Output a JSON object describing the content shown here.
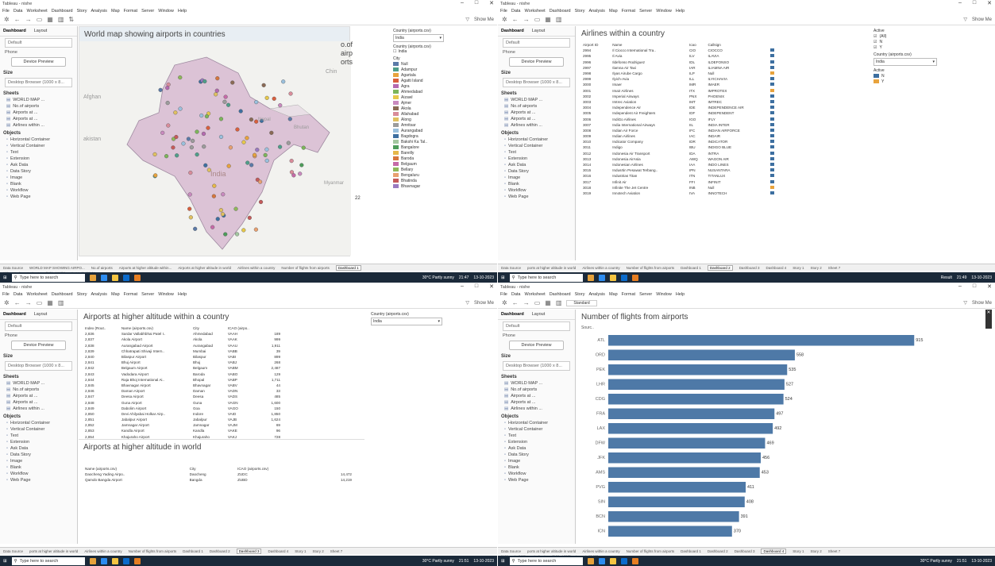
{
  "window_title": "Tableau - nishe",
  "menu": [
    "File",
    "Data",
    "Worksheet",
    "Dashboard",
    "Story",
    "Analysis",
    "Map",
    "Format",
    "Server",
    "Window",
    "Help"
  ],
  "show_me": "Show Me",
  "left_panel": {
    "tab_dashboard": "Dashboard",
    "tab_layout": "Layout",
    "default_label": "Default",
    "phone_label": "Phone",
    "device_preview": "Device Preview",
    "size_header": "Size",
    "size_value": "Desktop Browser (1000 x 8...",
    "sheets_header": "Sheets",
    "sheets": [
      "WORLD MAP ...",
      "No.of airports",
      "Airports at ...",
      "Airports at ...",
      "Airlines within ..."
    ],
    "objects_header": "Objects",
    "objects": [
      "Horizontal Container",
      "Vertical Container",
      "Text",
      "Extension",
      "Ask Data",
      "Data Story",
      "Image",
      "Blank",
      "Workflow",
      "Web Page"
    ]
  },
  "q1": {
    "title": "World map showing airports in countries",
    "overlay_text": "o.of\nairp\norts",
    "map_labels": [
      "Chin",
      "Afghan",
      "akistan",
      "Nepal",
      "Bhutan",
      "India",
      "Myanmar"
    ],
    "count_label": "22",
    "filter_label": "Country (airports.csv)",
    "filter_value": "India",
    "filter2_label": "Country (airports.csv)",
    "filter2_value": "India",
    "city_header": "City",
    "cities": [
      {
        "name": "Null",
        "color": "#5b7aa8"
      },
      {
        "name": "Adampur",
        "color": "#4f9e8a"
      },
      {
        "name": "Agartala",
        "color": "#e8a33d"
      },
      {
        "name": "Agatti Island",
        "color": "#d95f3d"
      },
      {
        "name": "Agra",
        "color": "#b56ab0"
      },
      {
        "name": "Ahmedabad",
        "color": "#7cb55a"
      },
      {
        "name": "Aizawl",
        "color": "#e6c84a"
      },
      {
        "name": "Ajmer",
        "color": "#c98abf"
      },
      {
        "name": "Akola",
        "color": "#8a6a55"
      },
      {
        "name": "Allahabad",
        "color": "#d98c9a"
      },
      {
        "name": "Along",
        "color": "#e0c060"
      },
      {
        "name": "Amritsar",
        "color": "#9c9c9c"
      },
      {
        "name": "Aurangabad",
        "color": "#9ac0dd"
      },
      {
        "name": "Bagdogra",
        "color": "#3d6fa0"
      },
      {
        "name": "Bakshi Ka Tal..",
        "color": "#a3c7a0"
      },
      {
        "name": "Bangalore",
        "color": "#4d9c5a"
      },
      {
        "name": "Bareilly",
        "color": "#e6b84a"
      },
      {
        "name": "Baroda",
        "color": "#d6763d"
      },
      {
        "name": "Belgaum",
        "color": "#c66aa8"
      },
      {
        "name": "Bellary",
        "color": "#8fb85a"
      },
      {
        "name": "Bengaluru",
        "color": "#e8a070"
      },
      {
        "name": "Bhatinda",
        "color": "#c55a5a"
      },
      {
        "name": "Bhavnagar",
        "color": "#9a7ac0"
      }
    ],
    "tabs": [
      "Data Source",
      "WORLD MAP SHOWING AIRPO...",
      "No.of airports",
      "Airports at higher altitude within...",
      "Airports at higher altitude in world",
      "Airlines within a country",
      "Number of flights from airports",
      "Dashboard 1"
    ],
    "status": "149 marks  1 row by 1 column  SUM of AVG(Longitude): 11,900.94",
    "weather": "30°C  Partly sunny",
    "time": "21:47",
    "date": "13-10-2023",
    "search": "Type here to search"
  },
  "q2": {
    "title": "Airlines within a country",
    "columns": [
      "Airport ID",
      "Name",
      "Icao",
      "Callsign"
    ],
    "rows": [
      [
        "2994",
        "Il Ciocco International Tra..",
        "CIO",
        "CIOCCO"
      ],
      [
        "2995",
        "Il Avia",
        "ILV",
        "ILAVIA"
      ],
      [
        "2996",
        "Ildefonso Rodriguez",
        "IDL",
        "ILDEFONSO"
      ],
      [
        "2997",
        "Ilamna Air Taxi",
        "IAR",
        "ILIAMNA AIR"
      ],
      [
        "2998",
        "Ilyas Airube Cargo",
        "ILP",
        "Null"
      ],
      [
        "2999",
        "Ilyich-Avia",
        "ILL",
        "ILYICHAVIA"
      ],
      [
        "3000",
        "Imaer",
        "IMR",
        "IMAER"
      ],
      [
        "3001",
        "Imair Airlines",
        "ITX",
        "IMPROTEX"
      ],
      [
        "3002",
        "Imperial Airways",
        "PNX",
        "PHOENIX"
      ],
      [
        "3003",
        "Imtrec Aviation",
        "IMT",
        "IMTREC"
      ],
      [
        "3004",
        "Independence Air",
        "IDE",
        "INDEPENDENCE AIR"
      ],
      [
        "3005",
        "Independent Air Freighters",
        "IDF",
        "INDEPENDENT"
      ],
      [
        "3006",
        "IndiGo Airlines",
        "IGO",
        "IFLY"
      ],
      [
        "3007",
        "India International Airways",
        "IIL",
        "INDIA INTER"
      ],
      [
        "3008",
        "Indian Air Force",
        "IFC",
        "INDIAN AIRFORCE"
      ],
      [
        "3009",
        "Indian Airlines",
        "IAC",
        "INDAIR"
      ],
      [
        "3010",
        "Indicator Company",
        "IDR",
        "INDICATOR"
      ],
      [
        "3011",
        "Indigo",
        "IBU",
        "INDIGO BLUE"
      ],
      [
        "3012",
        "Indonesia Air Transport",
        "IDA",
        "INTRA"
      ],
      [
        "3013",
        "Indonesia AirAsia",
        "AWQ",
        "WAGON AIR"
      ],
      [
        "3014",
        "Indonesian Airlines",
        "IAA",
        "INDO LINES"
      ],
      [
        "3015",
        "Indusrtin Pesawat Terbang..",
        "IPN",
        "NUSANTARA"
      ],
      [
        "3016",
        "Industrias Titan",
        "ITN",
        "TITANLUX"
      ],
      [
        "3017",
        "Infinit Air",
        "FFI",
        "INFINIT"
      ],
      [
        "3018",
        "Infinite The Jet Centre",
        "INB",
        "Null"
      ],
      [
        "3019",
        "Innotech Aviation",
        "IVA",
        "INNOTECH"
      ]
    ],
    "row_colors": [
      "#3d6fa0",
      "#3d6fa0",
      "#3d6fa0",
      "#3d6fa0",
      "#e8a33d",
      "#3d6fa0",
      "#3d6fa0",
      "#e8a33d",
      "#3d6fa0",
      "#3d6fa0",
      "#3d6fa0",
      "#3d6fa0",
      "#3d6fa0",
      "#3d6fa0",
      "#3d6fa0",
      "#3d6fa0",
      "#3d6fa0",
      "#3d6fa0",
      "#3d6fa0",
      "#3d6fa0",
      "#3d6fa0",
      "#3d6fa0",
      "#3d6fa0",
      "#3d6fa0",
      "#e8a33d",
      "#3d6fa0"
    ],
    "active_label": "Active",
    "active_options": [
      "(All)",
      "N",
      "Y"
    ],
    "country_label": "Country (airports.csv)",
    "country_value": "India",
    "active_legend": [
      {
        "name": "N",
        "color": "#3d6fa0"
      },
      {
        "name": "Y",
        "color": "#e8a33d"
      }
    ],
    "tabs": [
      "Data Source",
      "ports at higher altitude in world",
      "Airlines within a country",
      "Number of flights from airports",
      "Dashboard 1",
      "Dashboard 2",
      "Dashboard 3",
      "Dashboard 4",
      "Story 1",
      "Story 2",
      "Sheet 7"
    ],
    "tray": "Result",
    "time": "21:49",
    "date": "13-10-2023",
    "search": "Type here to search"
  },
  "q3": {
    "title": "Airports at higher altitude within a country",
    "columns": [
      "Index (Rout..",
      "Name (airports.csv)",
      "City",
      "ICAO (airpo.."
    ],
    "rows": [
      [
        "2,836",
        "Sardar Vallabhbhai Patel I..",
        "Ahmedabad",
        "VAAH",
        "189"
      ],
      [
        "2,837",
        "Akola Airport",
        "Akola",
        "VAAK",
        "999"
      ],
      [
        "2,838",
        "Aurangabad Airport",
        "Aurangabad",
        "VAAU",
        "1,911"
      ],
      [
        "2,839",
        "Chhatrapati Shivaji Intern..",
        "Mumbai",
        "VABB",
        "39"
      ],
      [
        "2,840",
        "Bilaspur Airport",
        "Bilaspur",
        "VABI",
        "899"
      ],
      [
        "2,841",
        "Bhuj Airport",
        "Bhuj",
        "VABJ",
        "268"
      ],
      [
        "2,842",
        "Belgaum Airport",
        "Belgaum",
        "VABM",
        "2,487"
      ],
      [
        "2,843",
        "Vadodara Airport",
        "Baroda",
        "VABO",
        "129"
      ],
      [
        "2,844",
        "Raja Bhoj International Ai..",
        "Bhopal",
        "VABP",
        "1,711"
      ],
      [
        "2,845",
        "Bhavnagar Airport",
        "Bhavnagar",
        "VABV",
        "44"
      ],
      [
        "2,846",
        "Daman Airport",
        "Daman",
        "VADN",
        "33"
      ],
      [
        "2,847",
        "Deesa Airport",
        "Deesa",
        "VADS",
        "485"
      ],
      [
        "2,848",
        "Guna Airport",
        "Guna",
        "VAGN",
        "1,600"
      ],
      [
        "2,849",
        "Dabolim Airport",
        "Goa",
        "VAGO",
        "150"
      ],
      [
        "2,850",
        "Devi Ahilyabai Holkar Airp..",
        "Indore",
        "VAID",
        "1,850"
      ],
      [
        "2,851",
        "Jabalpur Airport",
        "Jabalpur",
        "VAJB",
        "1,624"
      ],
      [
        "2,852",
        "Jamnagar Airport",
        "Jamnagar",
        "VAJM",
        "69"
      ],
      [
        "2,853",
        "Kandla Airport",
        "Kandla",
        "VAKE",
        "96"
      ],
      [
        "2,854",
        "Khajuraho Airport",
        "Khajuraho",
        "VAKJ",
        "728"
      ]
    ],
    "filter_label": "Country (airports.csv)",
    "filter_value": "India",
    "title2": "Airports at higher altitude in world",
    "columns2": [
      "Name (airports.csv)",
      "City",
      "ICAO (airports.csv)"
    ],
    "rows2": [
      [
        "Daocheng Yading Airpo..",
        "Daocheng",
        "ZUDC",
        "14,472"
      ],
      [
        "Qamdo Bangda Airport",
        "Bangda",
        "ZUBD",
        "14,219"
      ]
    ],
    "tabs": [
      "Data Source",
      "ports at higher altitude in world",
      "Airlines within a country",
      "Number of flights from airports",
      "Dashboard 1",
      "Dashboard 2",
      "Dashboard 3",
      "Dashboard 4",
      "Story 1",
      "Story 2",
      "Sheet 7"
    ],
    "weather": "30°C  Partly sunny",
    "time": "21:51",
    "date": "13-10-2023",
    "search": "Type here to search"
  },
  "q4": {
    "title": "Number of flights from airports",
    "col_label": "Sourc..",
    "status": "3409 marks  3409 rows by 1 column  SUM of CNT(routes.csv): 67,663",
    "tabs": [
      "Data Source",
      "ports at higher altitude in world",
      "Airlines within a country",
      "Number of flights from airports",
      "Dashboard 1",
      "Dashboard 2",
      "Dashboard 3",
      "Dashboard 4",
      "Story 1",
      "Story 2",
      "Sheet 7"
    ],
    "weather": "30°C  Partly sunny",
    "time": "21:51",
    "date": "13-10-2023",
    "search": "Type here to search",
    "toolbar_standard": "Standard"
  },
  "chart_data": {
    "type": "bar",
    "title": "Number of flights from airports",
    "categories": [
      "ATL",
      "ORD",
      "PEK",
      "LHR",
      "CDG",
      "FRA",
      "LAX",
      "DFW",
      "JFK",
      "AMS",
      "PVG",
      "SIN",
      "BCN",
      "ICN"
    ],
    "values": [
      915,
      558,
      535,
      527,
      524,
      497,
      492,
      469,
      456,
      453,
      411,
      408,
      391,
      370
    ],
    "xlim": [
      0,
      950
    ],
    "color": "#4e79a7"
  }
}
